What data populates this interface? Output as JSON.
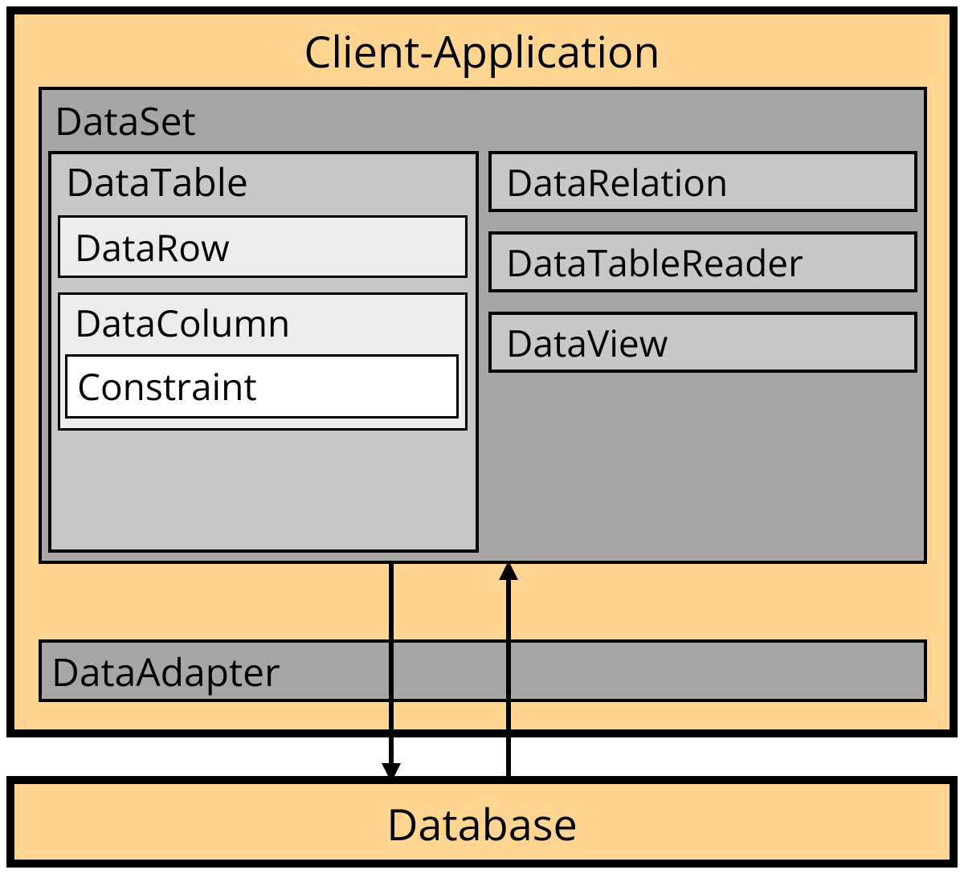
{
  "client_app": {
    "title": "Client-Application"
  },
  "dataset": {
    "title": "DataSet",
    "datatable": {
      "title": "DataTable",
      "datarow": "DataRow",
      "datacolumn": {
        "title": "DataColumn",
        "constraint": "Constraint"
      }
    },
    "datarelation": "DataRelation",
    "datatablereader": "DataTableReader",
    "dataview": "DataView"
  },
  "dataadapter": "DataAdapter",
  "database": "Database"
}
